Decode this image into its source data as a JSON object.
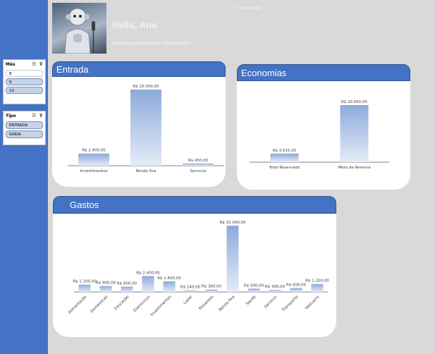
{
  "header": {
    "note": "Pesquisar Botão",
    "greeting": "Hello, Ana",
    "subtitle": "Acompanhamento Financeiro"
  },
  "slicers": [
    {
      "title": "Mês",
      "items": [
        {
          "label": "8",
          "selected": false
        },
        {
          "label": "9",
          "selected": true
        },
        {
          "label": "10",
          "selected": true
        }
      ]
    },
    {
      "title": "Tipo",
      "items": [
        {
          "label": "ENTRADA",
          "selected": true
        },
        {
          "label": "SAÍDA",
          "selected": true
        }
      ]
    }
  ],
  "cards": {
    "entrada": {
      "title": "Entrada"
    },
    "economias": {
      "title": "Economias"
    },
    "gastos": {
      "title": "Gastos"
    }
  },
  "colors": {
    "accent": "#4472c4",
    "bar_top": "#8eaadb",
    "bar_bottom": "#e3ebf7",
    "background": "#d9d9d9"
  },
  "chart_data": [
    {
      "id": "entrada",
      "type": "bar",
      "categories": [
        "Investimentos",
        "Renda fixa",
        "Servicos"
      ],
      "values": [
        2400,
        15000,
        450
      ],
      "labels": [
        "R$ 2.400,00",
        "R$ 15.000,00",
        "R$ 450,00"
      ],
      "ylim": [
        0,
        15000
      ],
      "grid": false
    },
    {
      "id": "economias",
      "type": "bar",
      "categories": [
        "Total Reservado",
        "Meta de Reserva"
      ],
      "values": [
        3015,
        20000
      ],
      "labels": [
        "R$ 3.015,00",
        "R$ 20.000,00"
      ],
      "ylim": [
        0,
        20000
      ],
      "grid": false
    },
    {
      "id": "gastos",
      "type": "bar",
      "categories": [
        "Alimentação",
        "Domesticas",
        "Educação",
        "Eletronicos",
        "Investimentos",
        "Lazer",
        "Presentes",
        "Renda fixa",
        "Saude",
        "Servicos",
        "Transporte",
        "Vestuario"
      ],
      "values": [
        1100,
        900,
        800,
        2400,
        1600,
        240,
        360,
        10000,
        500,
        300,
        600,
        1200
      ],
      "labels": [
        "R$ 1.100,00",
        "R$ 900,00",
        "R$ 800,00",
        "R$ 2.400,00",
        "R$ 1.600,00",
        "R$ 240,00",
        "R$ 360,00",
        "R$ 10.000,00",
        "R$ 500,00",
        "R$ 300,00",
        "R$ 600,00",
        "R$ 1.200,00"
      ],
      "ylim": [
        0,
        10000
      ],
      "grid": false
    }
  ]
}
